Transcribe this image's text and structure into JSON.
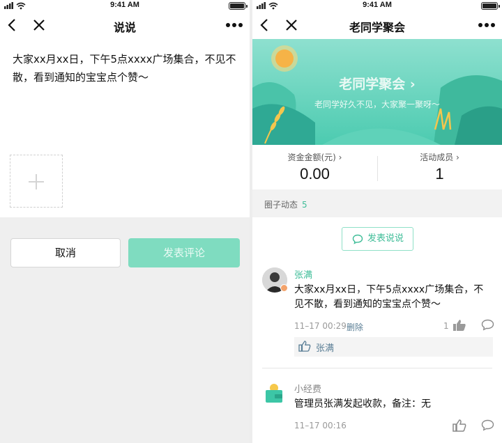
{
  "status_bar": {
    "time": "9:41 AM"
  },
  "left_screen": {
    "title": "说说",
    "post_text": "大家xx月xx日，下午5点xxxx广场集合，不见不散，看到通知的宝宝点个赞～",
    "cancel_label": "取消",
    "submit_label": "发表评论"
  },
  "right_screen": {
    "title": "老同学聚会",
    "banner": {
      "title": "老同学聚会 ›",
      "subtitle": "老同学好久不见，大家聚一聚呀～"
    },
    "stats": [
      {
        "label": "资金金额(元) ›",
        "value": "0.00"
      },
      {
        "label": "活动成员 ›",
        "value": "1"
      }
    ],
    "feed_header": {
      "label": "圈子动态",
      "count": "5"
    },
    "publish_label": "发表说说",
    "posts": [
      {
        "author": "张满",
        "text": "大家xx月xx日，下午5点xxxx广场集合，不见不散，看到通知的宝宝点个赞～",
        "time": "11–17 00:29",
        "delete_label": "删除",
        "like_count": "1",
        "liked_by": "张满"
      },
      {
        "author": "小经费",
        "text": "管理员张满发起收款，备注：无",
        "time": "11–17 00:16"
      }
    ]
  },
  "colors": {
    "accent": "#3fbd98",
    "button_disabled": "#7fdcc0",
    "banner": "#3cc6a6"
  }
}
